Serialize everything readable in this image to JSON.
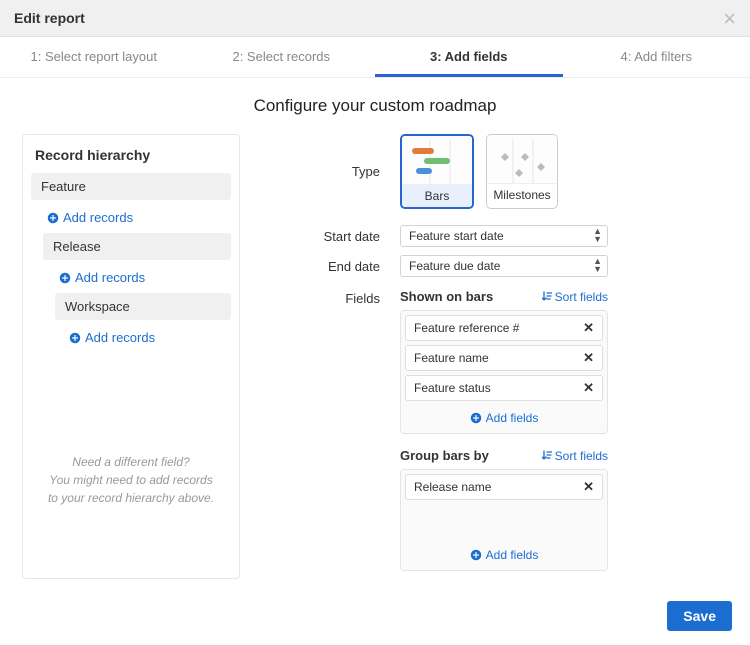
{
  "header": {
    "title": "Edit report"
  },
  "steps": [
    {
      "label": "1: Select report layout"
    },
    {
      "label": "2: Select records"
    },
    {
      "label": "3: Add fields",
      "active": true
    },
    {
      "label": "4: Add filters"
    }
  ],
  "page_title": "Configure your custom roadmap",
  "sidebar": {
    "title": "Record hierarchy",
    "nodes": [
      {
        "label": "Feature"
      },
      {
        "label": "Release"
      },
      {
        "label": "Workspace"
      }
    ],
    "add_records_label": "Add records",
    "hint_line1": "Need a different field?",
    "hint_line2": "You might need to add records",
    "hint_line3": "to your record hierarchy above."
  },
  "form": {
    "type_label": "Type",
    "type_options": [
      {
        "label": "Bars",
        "selected": true
      },
      {
        "label": "Milestones",
        "selected": false
      }
    ],
    "start_date_label": "Start date",
    "start_date_value": "Feature start date",
    "end_date_label": "End date",
    "end_date_value": "Feature due date",
    "fields_label": "Fields",
    "shown_on_bars": {
      "title": "Shown on bars",
      "sort_label": "Sort fields",
      "add_label": "Add fields",
      "items": [
        {
          "label": "Feature reference #"
        },
        {
          "label": "Feature name"
        },
        {
          "label": "Feature status"
        }
      ]
    },
    "group_bars_by": {
      "title": "Group bars by",
      "sort_label": "Sort fields",
      "add_label": "Add fields",
      "items": [
        {
          "label": "Release name"
        }
      ]
    }
  },
  "footer": {
    "save_label": "Save"
  },
  "colors": {
    "accent": "#1c6dd0"
  }
}
